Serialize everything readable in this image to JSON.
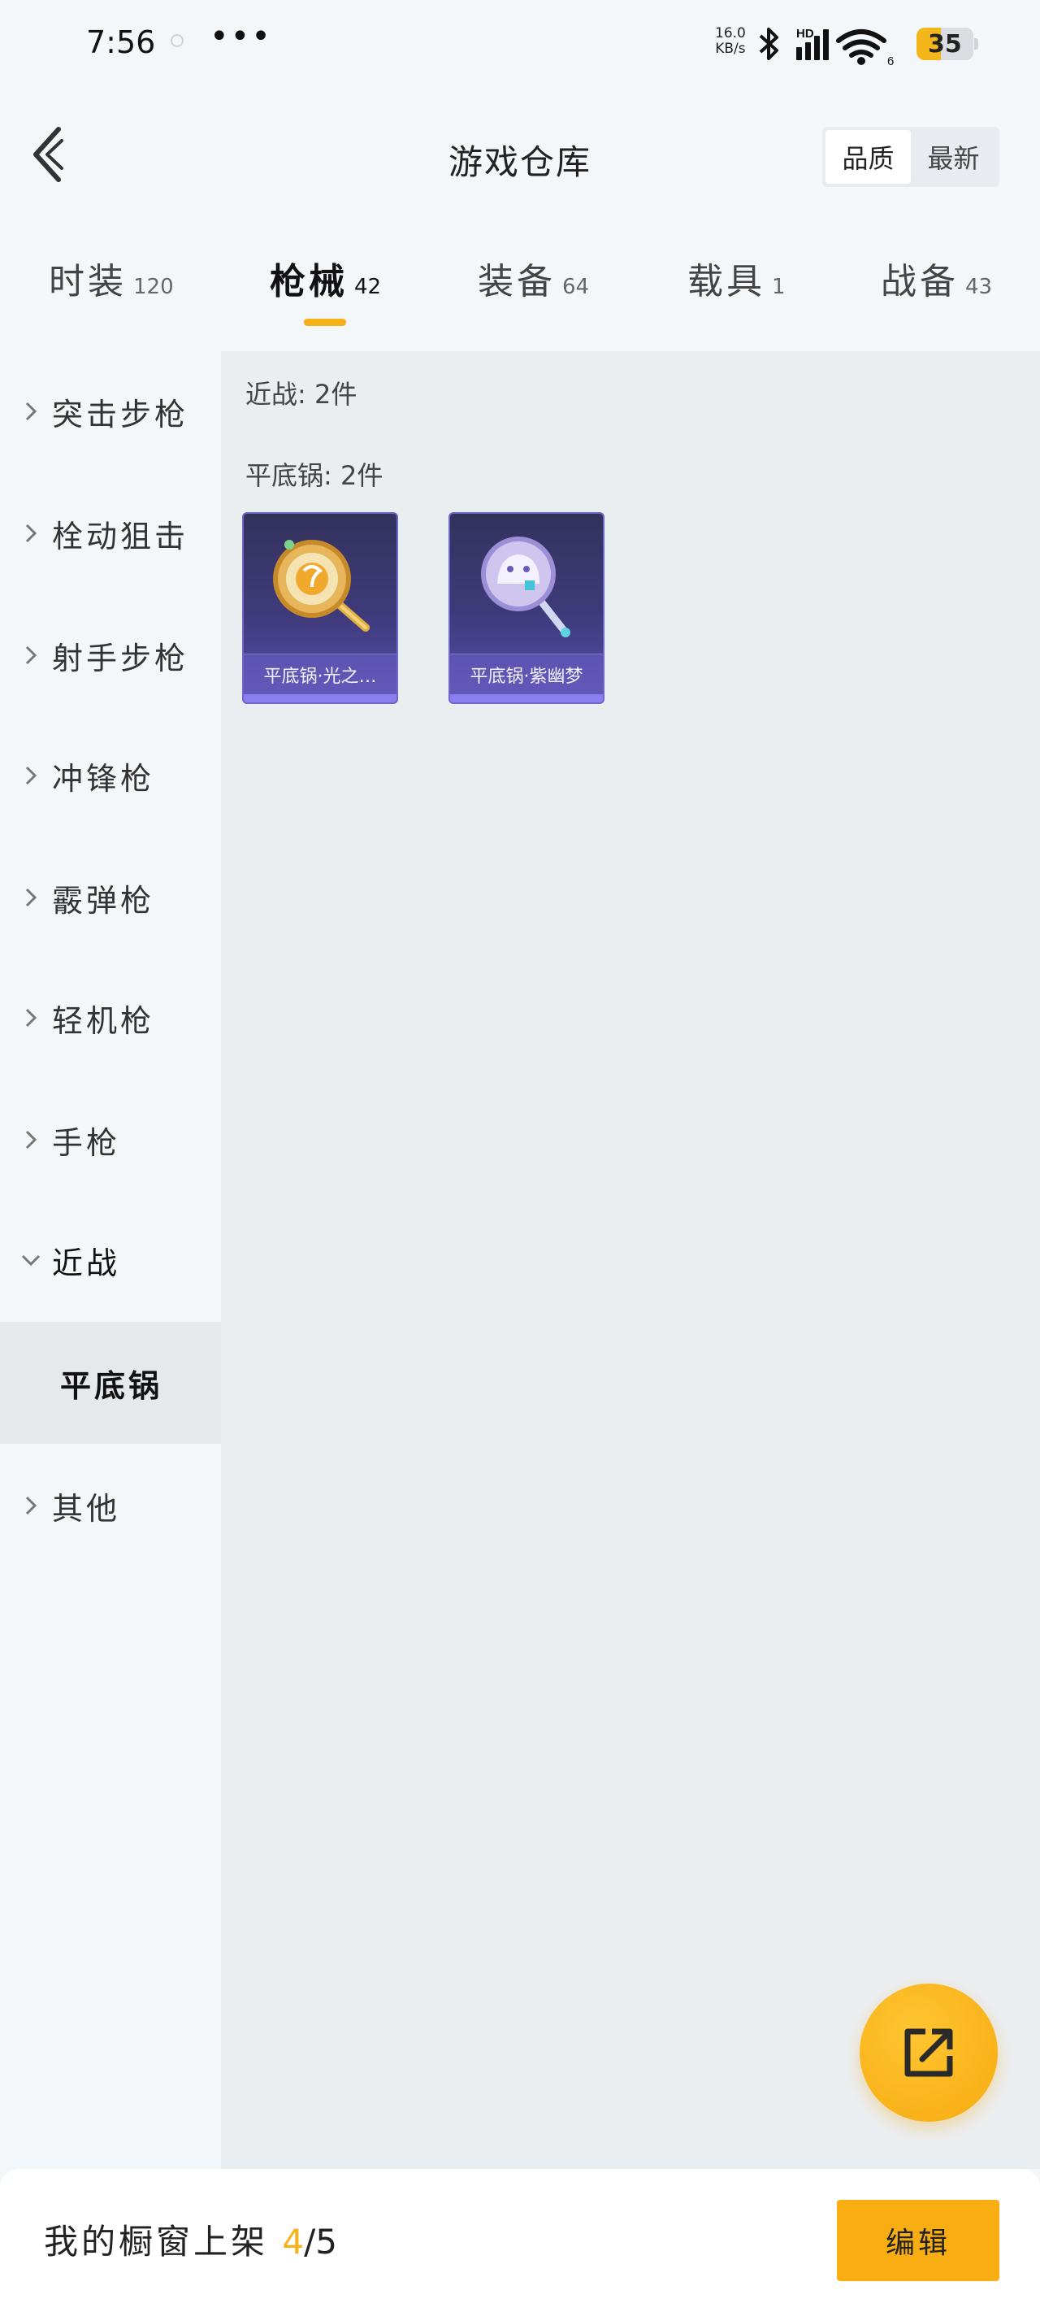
{
  "status_bar": {
    "time": "7:56",
    "more": "•••",
    "net_speed_value": "16.0",
    "net_speed_unit": "KB/s",
    "hd_label": "HD",
    "wifi_number": "6",
    "battery": "35"
  },
  "header": {
    "title": "游戏仓库",
    "sort_options": [
      "品质",
      "最新"
    ],
    "active_sort": "品质"
  },
  "tabs": [
    {
      "label": "时装",
      "count": "120"
    },
    {
      "label": "枪械",
      "count": "42"
    },
    {
      "label": "装备",
      "count": "64"
    },
    {
      "label": "载具",
      "count": "1"
    },
    {
      "label": "战备",
      "count": "43"
    }
  ],
  "active_tab": "枪械",
  "sidebar": {
    "items": [
      {
        "label": "突击步枪",
        "expanded": false
      },
      {
        "label": "栓动狙击",
        "expanded": false
      },
      {
        "label": "射手步枪",
        "expanded": false
      },
      {
        "label": "冲锋枪",
        "expanded": false
      },
      {
        "label": "霰弹枪",
        "expanded": false
      },
      {
        "label": "轻机枪",
        "expanded": false
      },
      {
        "label": "手枪",
        "expanded": false
      },
      {
        "label": "近战",
        "expanded": true
      },
      {
        "label": "其他",
        "expanded": false
      }
    ],
    "selected_sub": "平底锅"
  },
  "content": {
    "category_label": "近战: 2件",
    "group_label": "平底锅: 2件",
    "items": [
      {
        "name": "平底锅·光之…",
        "icon": "golden-frying-pan-icon"
      },
      {
        "name": "平底锅·紫幽梦",
        "icon": "purple-frying-pan-icon"
      }
    ]
  },
  "bottom": {
    "shelf_label": "我的橱窗上架",
    "shelf_current": "4",
    "shelf_total": "/5",
    "edit_label": "编辑"
  },
  "colors": {
    "accent": "#f5b21a",
    "card_purple": "#3f3b7c"
  }
}
